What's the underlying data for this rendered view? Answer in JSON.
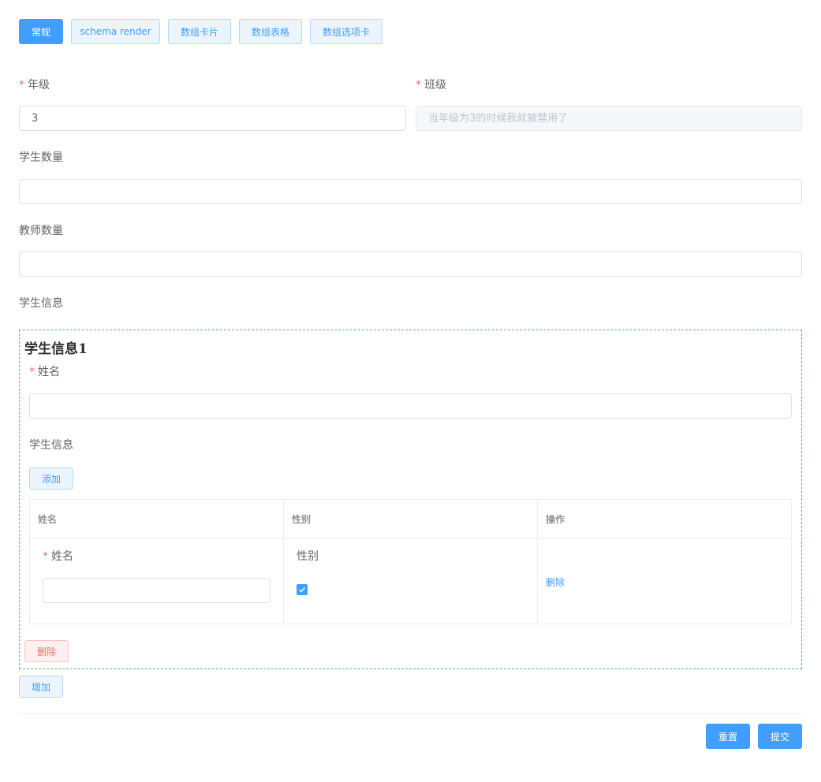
{
  "tabs": [
    {
      "label": "常规",
      "active": true
    },
    {
      "label": "schema render",
      "active": false
    },
    {
      "label": "数组卡片",
      "active": false
    },
    {
      "label": "数组表格",
      "active": false
    },
    {
      "label": "数组选项卡",
      "active": false
    }
  ],
  "form": {
    "grade": {
      "required_mark": "*",
      "label": "年级",
      "value": "3"
    },
    "class": {
      "required_mark": "*",
      "label": "班级",
      "placeholder": "当年级为3的时候我就被禁用了"
    },
    "student_count": {
      "label": "学生数量",
      "value": ""
    },
    "teacher_count": {
      "label": "教师数量",
      "value": ""
    },
    "student_info_label": "学生信息"
  },
  "card": {
    "title": "学生信息1",
    "name": {
      "required_mark": "*",
      "label": "姓名",
      "value": ""
    },
    "nested_label": "学生信息",
    "add_label": "添加",
    "table": {
      "headers": [
        "姓名",
        "性别",
        "操作"
      ],
      "row": {
        "name_required_mark": "*",
        "name_label": "姓名",
        "name_value": "",
        "gender_label": "性别",
        "gender_checked": true,
        "delete_label": "删除"
      }
    },
    "delete_label": "删除"
  },
  "increase_label": "增加",
  "actions": {
    "reset_label": "重置",
    "submit_label": "提交"
  },
  "colors": {
    "primary": "#409eff",
    "danger": "#f56c6c",
    "card_border": "#5cb87a"
  }
}
